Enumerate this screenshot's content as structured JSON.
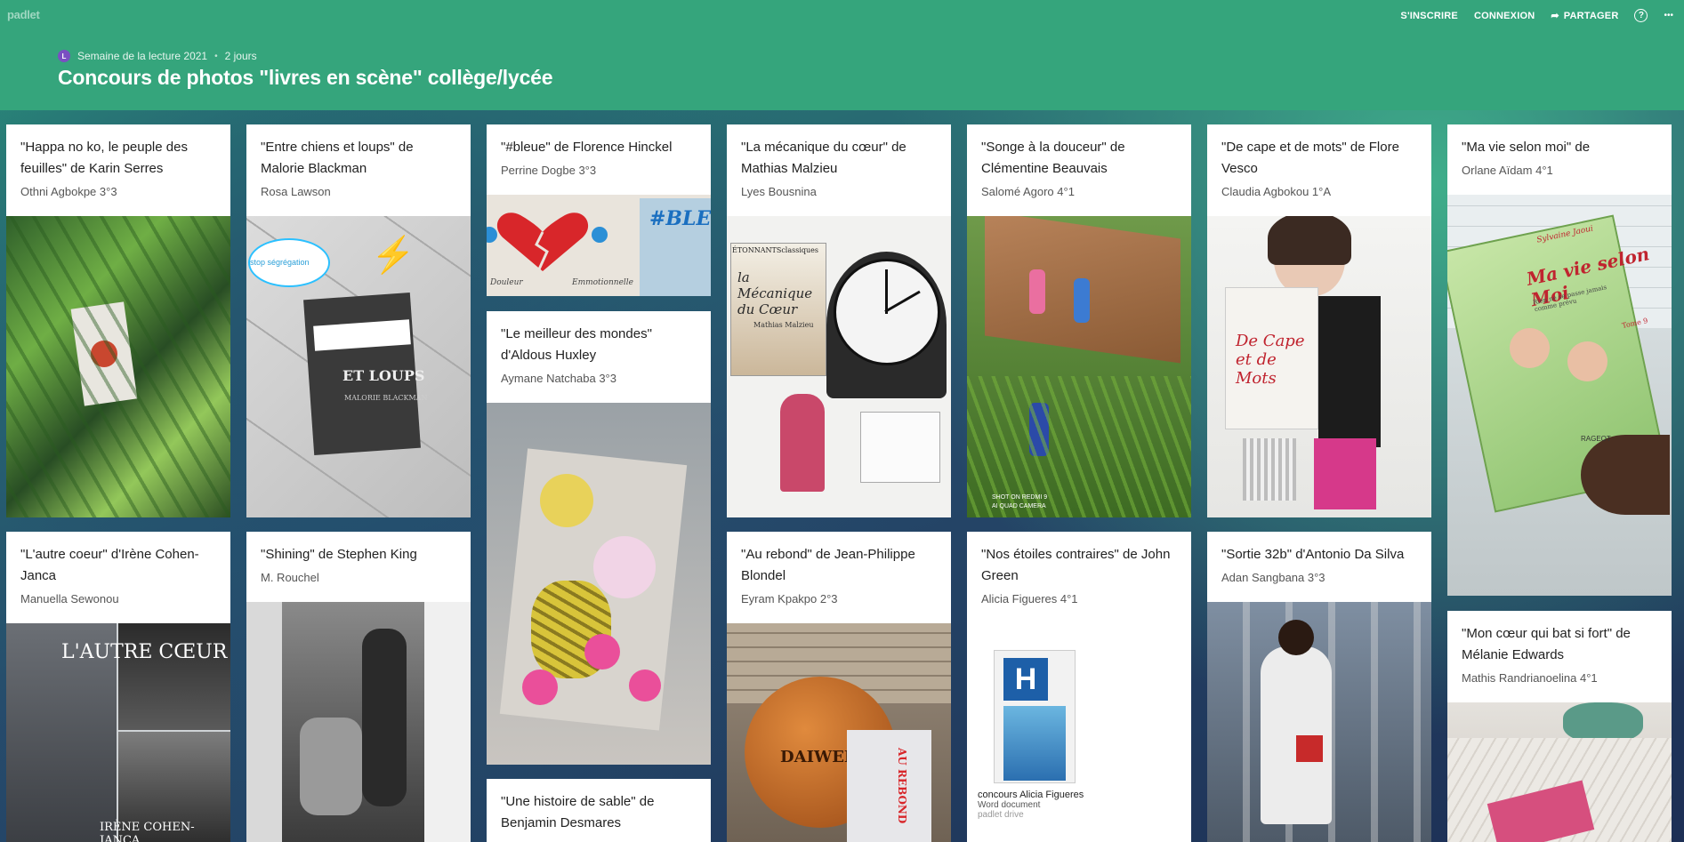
{
  "topbar": {
    "logo": "padlet",
    "signup": "S'INSCRIRE",
    "login": "CONNEXION",
    "share": "PARTAGER",
    "help": "?",
    "more": "•••"
  },
  "header": {
    "avatar_letter": "L",
    "author": "Semaine de la lecture 2021",
    "separator": "•",
    "age": "2 jours",
    "title": "Concours de photos \"livres en scène\" collège/lycée"
  },
  "posts": [
    {
      "title": "\"Happa no ko, le peuple des feuilles\" de Karin Serres",
      "author": "Othni Agbokpe 3°3"
    },
    {
      "title": "\"Entre chiens et loups\" de Malorie Blackman",
      "author": "Rosa Lawson",
      "sticker": "stop ségrégation",
      "cover_main": "ET LOUPS",
      "cover_author": "MALORIE BLACKMAN"
    },
    {
      "title": "\"#bleue\" de Florence Hinckel",
      "author": "Perrine Dogbe 3°3",
      "cover_text": "#BLEUE",
      "caption_left": "Douleur",
      "caption_right": "Emmotionnelle"
    },
    {
      "title": "\"Le meilleur des mondes\" d'Aldous Huxley",
      "author": "Aymane Natchaba 3°3"
    },
    {
      "title": "\"Une histoire de sable\" de Benjamin Desmares",
      "author": ""
    },
    {
      "title": "\"La mécanique du cœur\" de Mathias Malzieu",
      "author": "Lyes Bousnina",
      "cover_series": "ÉTONNANTSclassiques",
      "cover_title": "la Mécanique du Cœur",
      "cover_author": "Mathias Malzieu"
    },
    {
      "title": "\"Au rebond\" de Jean-Philippe Blondel",
      "author": "Eyram Kpakpo 2°3",
      "cover_text": "AU REBOND",
      "ball_brand": "DAIWEN"
    },
    {
      "title": "\"Songe à la douceur\" de Clémentine Beauvais",
      "author": "Salomé Agoro 4°1",
      "watermark_line1": "SHOT ON REDMI 9",
      "watermark_line2": "AI QUAD CAMERA"
    },
    {
      "title": "\"Nos étoiles contraires\" de John Green",
      "author": "Alicia Figueres 4°1",
      "attachment_title": "concours Alicia Figueres",
      "attachment_type": "Word document",
      "attachment_source": "padlet drive",
      "sign_letter": "H"
    },
    {
      "title": "\"De cape et de mots\" de Flore Vesco",
      "author": "Claudia Agbokou 1°A",
      "cover_text": "De Cape et de Mots"
    },
    {
      "title": "\"Sortie 32b\" d'Antonio Da Silva",
      "author": "Adan Sangbana 3°3"
    },
    {
      "title": "\"Ma vie selon moi\" de",
      "author": "Orlane Aïdam 4°1",
      "cover_title": "Ma vie selon Moi",
      "cover_tagline": "Rien ne se passe jamais comme prévu",
      "cover_author": "Sylvaine Jaoui",
      "cover_tome": "Tome 9",
      "cover_publisher": "RAGEOT"
    },
    {
      "title": "\"Mon cœur qui bat si fort\" de Mélanie Edwards",
      "author": "Mathis Randrianoelina  4°1"
    },
    {
      "title": "\"L'autre coeur\" d'Irène Cohen-Janca",
      "author": "Manuella Sewonou",
      "overlay_top": "L'AUTRE CŒUR",
      "overlay_bottom": "IRÈNE COHEN-JANCA"
    },
    {
      "title": "\"Shining\" de Stephen King",
      "author": "M. Rouchel"
    }
  ]
}
